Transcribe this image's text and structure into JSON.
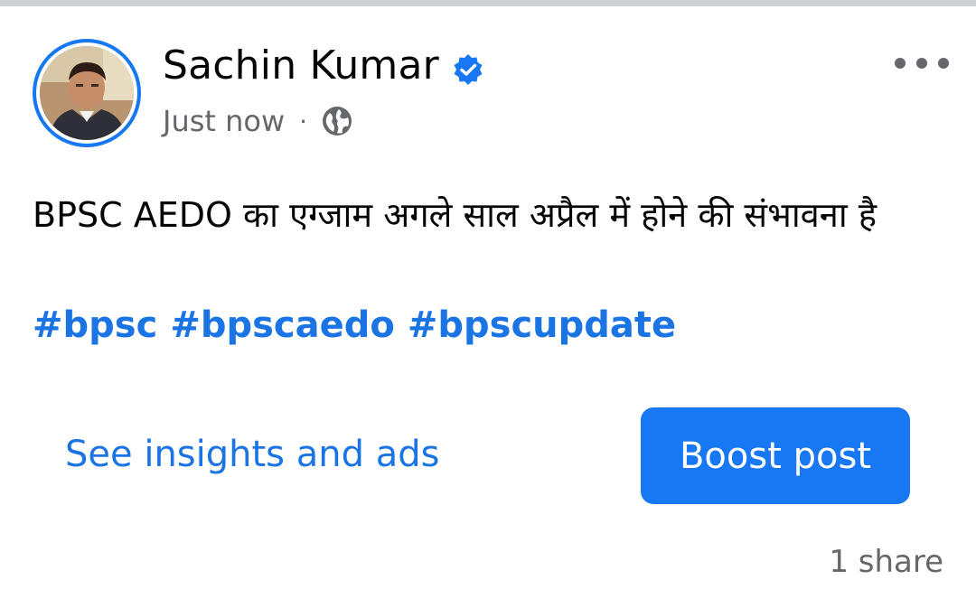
{
  "post": {
    "author": {
      "name": "Sachin Kumar",
      "verified": true
    },
    "timestamp": "Just now",
    "separator": "·",
    "audience_icon": "globe-icon",
    "text": "BPSC AEDO का एग्जाम अगले साल अप्रैल में होने की संभावना है",
    "hashtags": [
      "#bpsc",
      "#bpscaedo",
      "#bpscupdate"
    ],
    "more_icon": "more-horizontal-icon"
  },
  "actions": {
    "insights_label": "See insights and ads",
    "boost_label": "Boost post"
  },
  "footer": {
    "share_count": "1 share"
  },
  "colors": {
    "accent": "#1877f2",
    "link": "#1b74e4",
    "secondary_text": "#65676b",
    "primary_text": "#050505",
    "divider": "#ced0d4"
  }
}
